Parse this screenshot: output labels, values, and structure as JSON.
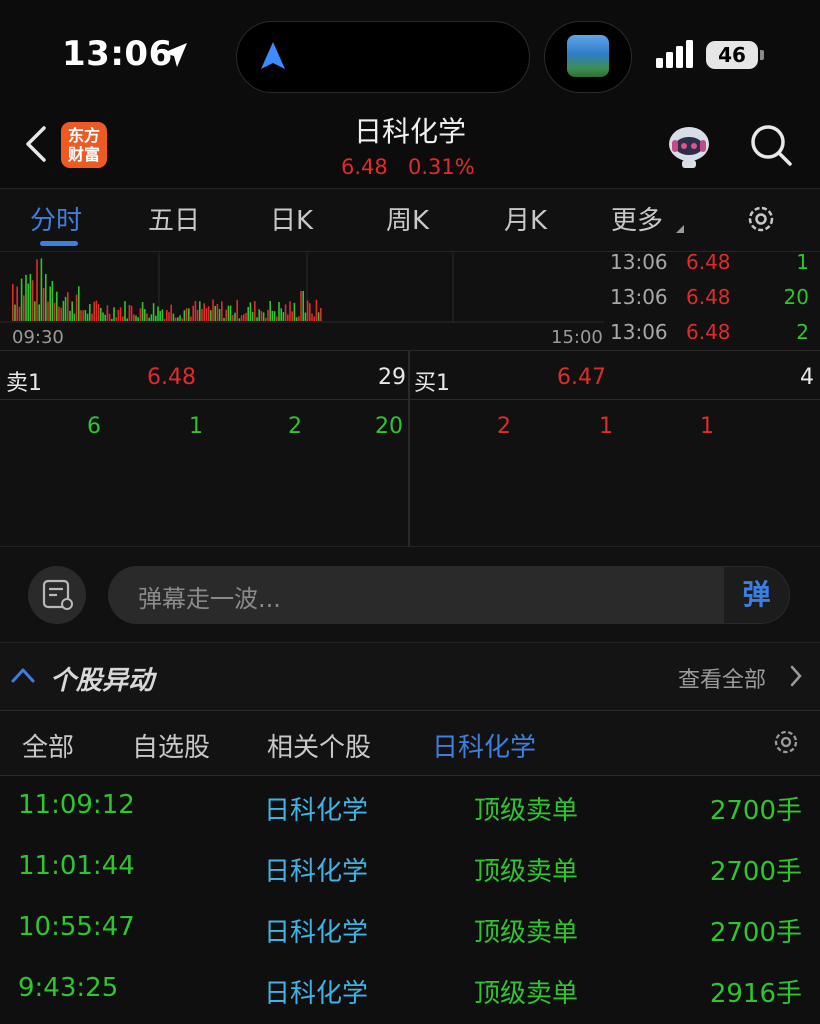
{
  "status_bar": {
    "time": "13:06",
    "battery": "46"
  },
  "header": {
    "logo_text": "东方财富",
    "title": "日科化学",
    "price": "6.48",
    "change_pct": "0.31%"
  },
  "chart_tabs": [
    {
      "label": "分时",
      "active": true
    },
    {
      "label": "五日",
      "active": false
    },
    {
      "label": "日K",
      "active": false
    },
    {
      "label": "周K",
      "active": false
    },
    {
      "label": "月K",
      "active": false
    },
    {
      "label": "更多",
      "active": false
    }
  ],
  "chart": {
    "x_start": "09:30",
    "x_end": "15:00",
    "colors": {
      "up": "#e02b2b",
      "down": "#2ec52e"
    }
  },
  "trades": [
    {
      "time": "13:06",
      "price": "6.48",
      "volume": "1"
    },
    {
      "time": "13:06",
      "price": "6.48",
      "volume": "20"
    },
    {
      "time": "13:06",
      "price": "6.48",
      "volume": "2"
    }
  ],
  "order_book": {
    "sell": {
      "label": "卖1",
      "price": "6.48",
      "volume": "29",
      "queue": [
        "6",
        "1",
        "2",
        "20"
      ]
    },
    "buy": {
      "label": "买1",
      "price": "6.47",
      "volume": "4",
      "queue": [
        "2",
        "1",
        "1"
      ]
    }
  },
  "danmaku": {
    "placeholder": "弹幕走一波...",
    "send_label": "弹"
  },
  "alerts": {
    "title": "个股异动",
    "view_all": "查看全部",
    "filters": [
      {
        "label": "全部",
        "active": false
      },
      {
        "label": "自选股",
        "active": false
      },
      {
        "label": "相关个股",
        "active": false
      },
      {
        "label": "日科化学",
        "active": true
      }
    ],
    "rows": [
      {
        "time": "11:09:12",
        "name": "日科化学",
        "type": "顶级卖单",
        "volume": "2700手"
      },
      {
        "time": "11:01:44",
        "name": "日科化学",
        "type": "顶级卖单",
        "volume": "2700手"
      },
      {
        "time": "10:55:47",
        "name": "日科化学",
        "type": "顶级卖单",
        "volume": "2700手"
      },
      {
        "time": "9:43:25",
        "name": "日科化学",
        "type": "顶级卖单",
        "volume": "2916手"
      }
    ]
  }
}
